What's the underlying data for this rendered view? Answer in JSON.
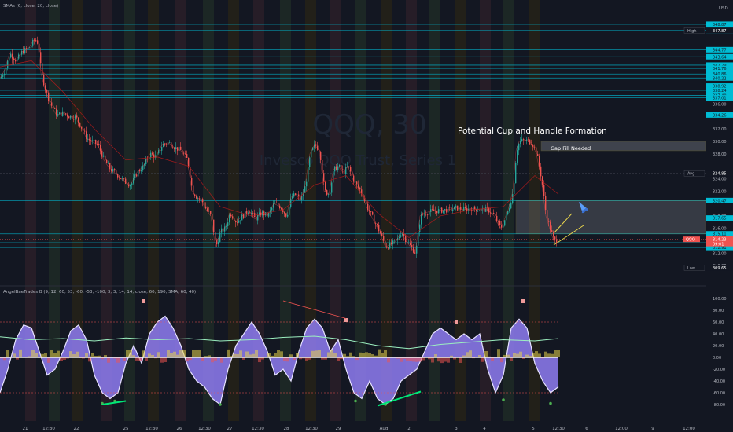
{
  "header": {
    "indicator_label": "SMAs (6, close, 20, close)",
    "currency": "USD"
  },
  "watermark": {
    "symbol": "QQQ, 30",
    "name": "Invesco QQQ Trust, Series 1"
  },
  "annotations": {
    "pattern_title": "Potential Cup and Handle Formation",
    "gap_label": "Gap Fill Needed"
  },
  "price_axis": {
    "ticks": [
      "336.00",
      "332.00",
      "330.00",
      "328.00",
      "324.00",
      "322.00",
      "318.00",
      "316.00",
      "314.00",
      "312.00",
      "310.00"
    ],
    "levels": [
      "348.87",
      "347.87",
      "344.77",
      "343.64",
      "342.29",
      "341.76",
      "340.86",
      "340.22",
      "338.92",
      "338.24",
      "337.40",
      "337.01",
      "334.26",
      "320.47",
      "317.65",
      "315.11",
      "313.68",
      "312.91"
    ],
    "high_tag": "High",
    "high_value": "347.87",
    "avg_tag": "Avg",
    "avg_value": "324.85",
    "symbol_tag": "QQQ",
    "last_price": "314.23",
    "countdown": "09:01",
    "low_tag": "Low",
    "low_value": "309.65"
  },
  "indicator_panel": {
    "label": "AngelBaeTrades B (9, 12, 60, 53, -60, -53, -100, 3, 3, 14, 14, close, 60, 190, SMA, 60, 40)",
    "ticks": [
      "100.00",
      "80.00",
      "60.00",
      "40.00",
      "20.00",
      "0.00",
      "-20.00",
      "-40.00",
      "-60.00",
      "-80.00"
    ]
  },
  "time_axis": {
    "ticks": [
      "21",
      "12:30",
      "22",
      "25",
      "12:30",
      "26",
      "12:30",
      "27",
      "12:30",
      "28",
      "12:30",
      "29",
      "Aug",
      "2",
      "3",
      "4",
      "5",
      "12:30",
      "6",
      "12:00",
      "9",
      "12:00"
    ]
  },
  "colors": {
    "background": "#131722",
    "bull": "#26a69a",
    "bear": "#ef5350",
    "level_line": "#00bcd4",
    "sma_fast": "#ef5350",
    "purple_fill": "#8f7cf2",
    "green_line": "#9cf0c0",
    "yellow_fill": "#e8d44d"
  },
  "chart_data": {
    "type": "candlestick",
    "symbol": "QQQ",
    "interval": "30",
    "ylim": [
      309.0,
      350.0
    ],
    "close_path": [
      [
        0,
        340.2
      ],
      [
        6,
        341.5
      ],
      [
        12,
        344.2
      ],
      [
        20,
        343.0
      ],
      [
        28,
        344.5
      ],
      [
        36,
        345.0
      ],
      [
        44,
        346.5
      ],
      [
        48,
        345.8
      ],
      [
        52,
        341.0
      ],
      [
        58,
        338.0
      ],
      [
        64,
        336.0
      ],
      [
        72,
        334.2
      ],
      [
        80,
        334.6
      ],
      [
        88,
        334.0
      ],
      [
        96,
        333.9
      ],
      [
        104,
        332.0
      ],
      [
        110,
        330.5
      ],
      [
        116,
        330.0
      ],
      [
        124,
        329.5
      ],
      [
        132,
        327.0
      ],
      [
        140,
        325.5
      ],
      [
        150,
        324.5
      ],
      [
        158,
        323.5
      ],
      [
        166,
        323.0
      ],
      [
        174,
        325.0
      ],
      [
        182,
        326.0
      ],
      [
        190,
        328.0
      ],
      [
        198,
        327.5
      ],
      [
        206,
        329.5
      ],
      [
        214,
        329.8
      ],
      [
        222,
        329.0
      ],
      [
        230,
        328.5
      ],
      [
        238,
        327.0
      ],
      [
        244,
        322.0
      ],
      [
        250,
        321.0
      ],
      [
        256,
        320.5
      ],
      [
        262,
        319.0
      ],
      [
        268,
        318.0
      ],
      [
        274,
        313.0
      ],
      [
        280,
        315.5
      ],
      [
        286,
        316.0
      ],
      [
        292,
        318.5
      ],
      [
        300,
        317.0
      ],
      [
        308,
        318.0
      ],
      [
        316,
        319.0
      ],
      [
        324,
        317.5
      ],
      [
        332,
        318.5
      ],
      [
        340,
        318.0
      ],
      [
        348,
        320.0
      ],
      [
        356,
        319.5
      ],
      [
        364,
        318.0
      ],
      [
        370,
        321.0
      ],
      [
        376,
        321.5
      ],
      [
        382,
        320.5
      ],
      [
        388,
        323.0
      ],
      [
        394,
        328.0
      ],
      [
        400,
        329.5
      ],
      [
        406,
        328.5
      ],
      [
        412,
        322.0
      ],
      [
        418,
        321.5
      ],
      [
        424,
        325.5
      ],
      [
        430,
        326.0
      ],
      [
        436,
        325.0
      ],
      [
        442,
        326.0
      ],
      [
        450,
        323.5
      ],
      [
        458,
        322.0
      ],
      [
        466,
        319.5
      ],
      [
        474,
        317.5
      ],
      [
        482,
        315.5
      ],
      [
        490,
        313.0
      ],
      [
        498,
        313.5
      ],
      [
        504,
        314.0
      ],
      [
        510,
        315.5
      ],
      [
        516,
        314.0
      ],
      [
        522,
        313.0
      ],
      [
        528,
        312.0
      ],
      [
        534,
        318.0
      ],
      [
        540,
        318.5
      ],
      [
        550,
        318.8
      ],
      [
        560,
        318.9
      ],
      [
        570,
        319.0
      ],
      [
        580,
        319.3
      ],
      [
        590,
        319.0
      ],
      [
        600,
        319.2
      ],
      [
        610,
        319.0
      ],
      [
        620,
        319.0
      ],
      [
        628,
        318.0
      ],
      [
        636,
        316.0
      ],
      [
        640,
        317.0
      ],
      [
        646,
        319.0
      ],
      [
        652,
        322.0
      ],
      [
        656,
        328.5
      ],
      [
        660,
        330.0
      ],
      [
        668,
        330.2
      ],
      [
        676,
        329.8
      ],
      [
        682,
        328.0
      ],
      [
        688,
        324.0
      ],
      [
        694,
        318.0
      ],
      [
        700,
        315.5
      ],
      [
        704,
        314.0
      ],
      [
        710,
        314.23
      ]
    ],
    "sma_slow_path": [
      [
        0,
        342.0
      ],
      [
        40,
        343.0
      ],
      [
        80,
        338.0
      ],
      [
        120,
        332.0
      ],
      [
        160,
        327.0
      ],
      [
        200,
        327.5
      ],
      [
        240,
        326.0
      ],
      [
        280,
        319.5
      ],
      [
        320,
        318.0
      ],
      [
        360,
        319.0
      ],
      [
        400,
        323.0
      ],
      [
        440,
        324.5
      ],
      [
        480,
        318.5
      ],
      [
        520,
        314.5
      ],
      [
        560,
        318.0
      ],
      [
        600,
        319.0
      ],
      [
        640,
        319.5
      ],
      [
        680,
        324.5
      ],
      [
        710,
        321.5
      ]
    ],
    "horizontal_levels": [
      348.87,
      347.87,
      344.77,
      343.64,
      342.29,
      341.76,
      340.86,
      340.22,
      338.92,
      338.24,
      337.4,
      337.01,
      334.26,
      320.47,
      317.65,
      315.11,
      313.68,
      312.91
    ],
    "gap_zone": [
      320.47,
      315.11
    ],
    "resistance_box": [
      330.0,
      328.5
    ],
    "high": 347.87,
    "low": 309.65,
    "last": 314.23,
    "average": 324.85,
    "indicator": {
      "ylim": [
        -100,
        100
      ],
      "overbought": 60,
      "oversold": -60,
      "purple_area_path": [
        [
          0,
          -60
        ],
        [
          10,
          -20
        ],
        [
          20,
          30
        ],
        [
          30,
          55
        ],
        [
          40,
          50
        ],
        [
          50,
          10
        ],
        [
          60,
          -30
        ],
        [
          70,
          -20
        ],
        [
          80,
          10
        ],
        [
          90,
          45
        ],
        [
          100,
          55
        ],
        [
          110,
          30
        ],
        [
          120,
          -30
        ],
        [
          130,
          -60
        ],
        [
          140,
          -70
        ],
        [
          150,
          -60
        ],
        [
          160,
          -10
        ],
        [
          170,
          20
        ],
        [
          180,
          -10
        ],
        [
          190,
          40
        ],
        [
          200,
          60
        ],
        [
          210,
          70
        ],
        [
          220,
          50
        ],
        [
          230,
          20
        ],
        [
          240,
          -20
        ],
        [
          250,
          -40
        ],
        [
          260,
          -50
        ],
        [
          270,
          -70
        ],
        [
          280,
          -80
        ],
        [
          290,
          -20
        ],
        [
          300,
          20
        ],
        [
          310,
          40
        ],
        [
          320,
          60
        ],
        [
          330,
          40
        ],
        [
          340,
          10
        ],
        [
          350,
          -30
        ],
        [
          360,
          -20
        ],
        [
          370,
          -40
        ],
        [
          380,
          10
        ],
        [
          390,
          50
        ],
        [
          400,
          65
        ],
        [
          410,
          50
        ],
        [
          420,
          10
        ],
        [
          430,
          30
        ],
        [
          440,
          -20
        ],
        [
          450,
          -60
        ],
        [
          460,
          -70
        ],
        [
          470,
          -40
        ],
        [
          480,
          -70
        ],
        [
          490,
          -80
        ],
        [
          500,
          -70
        ],
        [
          510,
          -40
        ],
        [
          520,
          -30
        ],
        [
          530,
          -20
        ],
        [
          540,
          10
        ],
        [
          550,
          40
        ],
        [
          560,
          50
        ],
        [
          570,
          40
        ],
        [
          580,
          30
        ],
        [
          590,
          40
        ],
        [
          600,
          30
        ],
        [
          610,
          40
        ],
        [
          620,
          -20
        ],
        [
          630,
          -60
        ],
        [
          640,
          -30
        ],
        [
          650,
          50
        ],
        [
          660,
          65
        ],
        [
          670,
          50
        ],
        [
          680,
          -10
        ],
        [
          690,
          -40
        ],
        [
          700,
          -60
        ],
        [
          710,
          -50
        ]
      ],
      "green_line_path": [
        [
          0,
          35
        ],
        [
          40,
          30
        ],
        [
          80,
          32
        ],
        [
          120,
          28
        ],
        [
          160,
          33
        ],
        [
          200,
          30
        ],
        [
          240,
          32
        ],
        [
          280,
          28
        ],
        [
          320,
          30
        ],
        [
          360,
          34
        ],
        [
          400,
          36
        ],
        [
          440,
          30
        ],
        [
          480,
          20
        ],
        [
          520,
          15
        ],
        [
          560,
          22
        ],
        [
          600,
          26
        ],
        [
          640,
          30
        ],
        [
          680,
          28
        ],
        [
          710,
          32
        ]
      ]
    }
  }
}
